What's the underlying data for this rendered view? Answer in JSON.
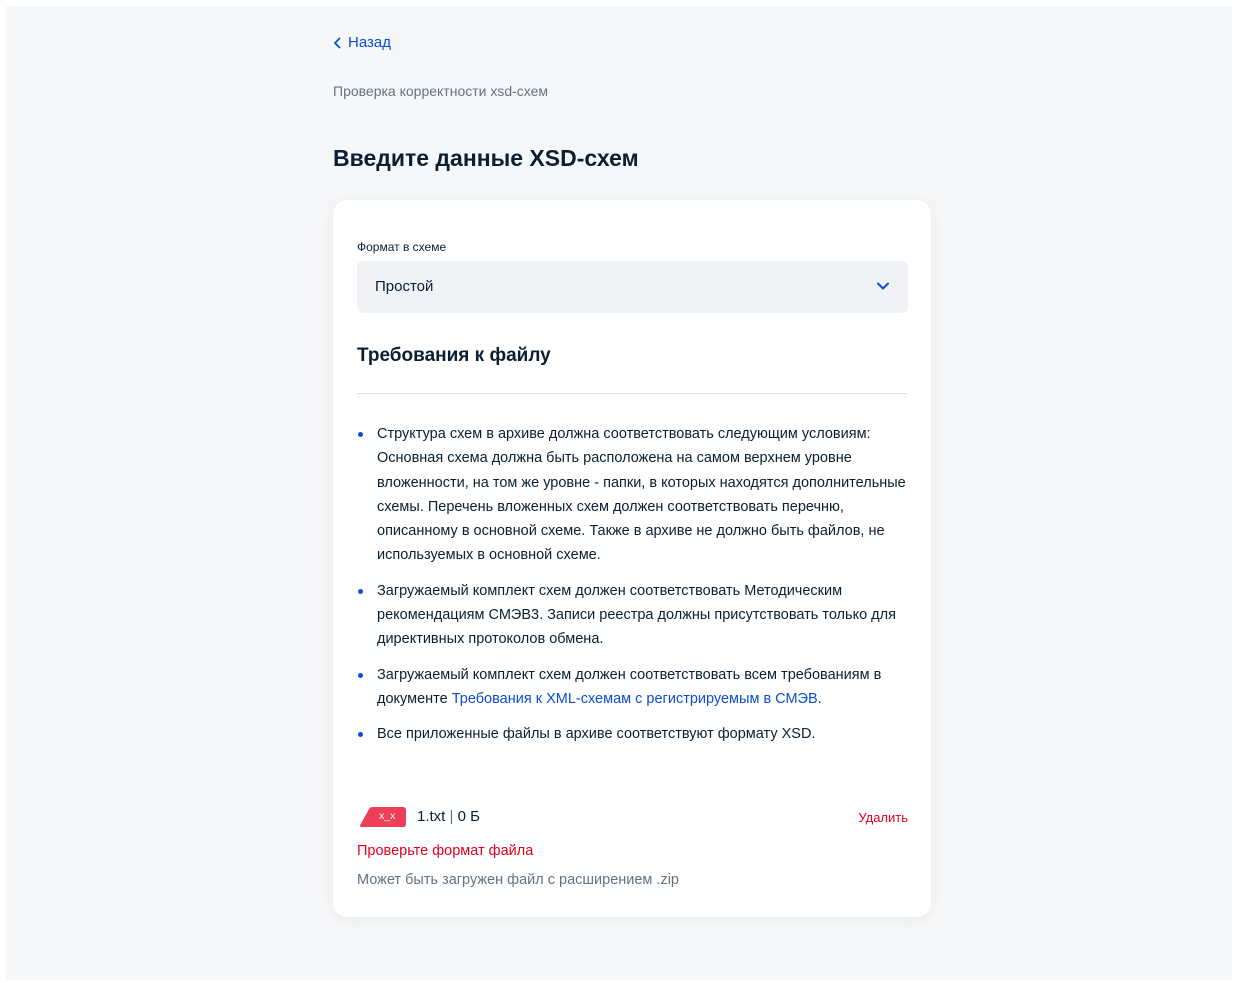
{
  "nav": {
    "back_label": "Назад",
    "breadcrumb": "Проверка корректности xsd-схем"
  },
  "page": {
    "title": "Введите данные XSD-схем"
  },
  "form": {
    "format_label": "Формат в схеме",
    "format_value": "Простой"
  },
  "requirements": {
    "title": "Требования к файлу",
    "items": [
      {
        "text": "Структура схем в архиве должна соответствовать следующим условиям: Основная схема должна быть расположена на самом верхнем уровне вложенности, на том же уровне - папки, в которых находятся дополнительные схемы. Перечень вложенных схем должен соответствовать перечню, описанному в основной схеме. Также в архиве не должно быть файлов, не используемых в основной схеме."
      },
      {
        "text": "Загружаемый комплект схем должен соответствовать Методическим рекомендациям СМЭВ3. Записи реестра должны присутствовать только для директивных протоколов обмена."
      },
      {
        "text_before": "Загружаемый комплект схем должен соответствовать всем требованиям в документе ",
        "link": "Требования к XML-схемам с регистрируемым в СМЭВ",
        "text_after": "."
      },
      {
        "text": "Все приложенные файлы в архиве соответствуют формату XSD."
      }
    ]
  },
  "file": {
    "badge": "x_x",
    "name": "1.txt",
    "separator": "|",
    "size": "0 Б",
    "delete_label": "Удалить",
    "error": "Проверьте формат файла",
    "hint": "Может быть загружен файл с расширением .zip"
  },
  "colors": {
    "accent": "#0d4cd3",
    "error": "#e1001e",
    "text": "#0b1f33",
    "muted": "#66727f"
  },
  "icons": {
    "back": "chevron-left-icon",
    "select": "chevron-down-icon",
    "file": "broken-file-icon"
  }
}
